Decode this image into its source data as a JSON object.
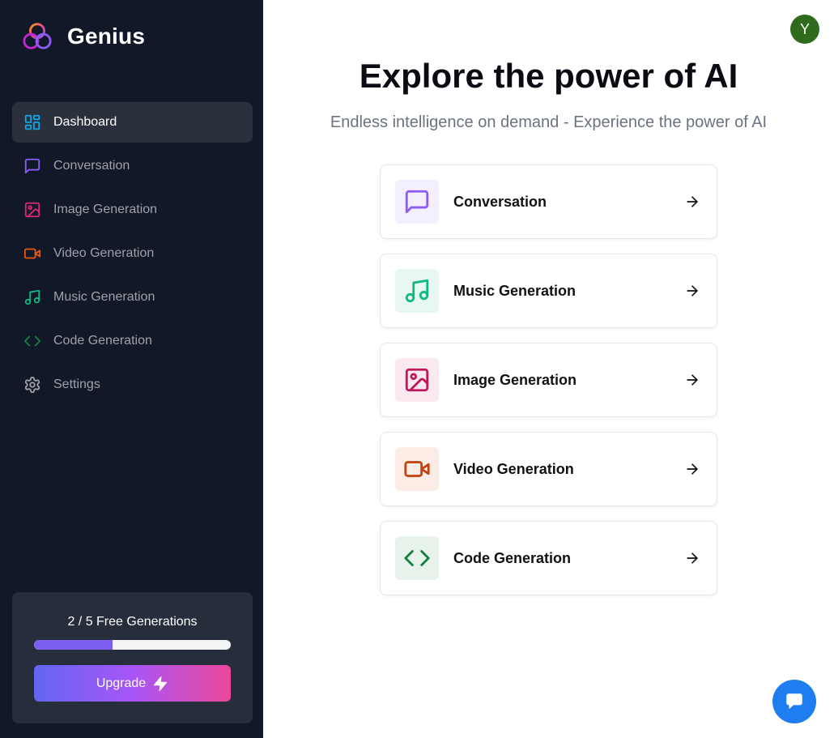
{
  "brand": {
    "name": "Genius"
  },
  "sidebar": {
    "items": [
      {
        "label": "Dashboard",
        "icon": "layout-dashboard-icon",
        "color": "#0ea5e9",
        "active": true
      },
      {
        "label": "Conversation",
        "icon": "message-square-icon",
        "color": "#8b5cf6",
        "active": false
      },
      {
        "label": "Image Generation",
        "icon": "image-icon",
        "color": "#db2777",
        "active": false
      },
      {
        "label": "Video Generation",
        "icon": "video-icon",
        "color": "#ea580c",
        "active": false
      },
      {
        "label": "Music Generation",
        "icon": "music-icon",
        "color": "#10b981",
        "active": false
      },
      {
        "label": "Code Generation",
        "icon": "code-icon",
        "color": "#15803d",
        "active": false
      },
      {
        "label": "Settings",
        "icon": "settings-icon",
        "color": "#a1a1aa",
        "active": false
      }
    ]
  },
  "usage": {
    "text": "2 / 5 Free Generations",
    "used": 2,
    "limit": 5,
    "upgrade_label": "Upgrade"
  },
  "header": {
    "avatar_initial": "Y",
    "avatar_color": "#2f6b1c"
  },
  "main": {
    "title": "Explore the power of AI",
    "subtitle": "Endless intelligence on demand - Experience the power of AI",
    "tools": [
      {
        "label": "Conversation",
        "icon": "message-square-icon",
        "color": "#8b5cf6",
        "bg": "#f3effe"
      },
      {
        "label": "Music Generation",
        "icon": "music-icon",
        "color": "#10b981",
        "bg": "#e8f8f1"
      },
      {
        "label": "Image Generation",
        "icon": "image-icon",
        "color": "#be185d",
        "bg": "#fbe9f0"
      },
      {
        "label": "Video Generation",
        "icon": "video-icon",
        "color": "#c2410c",
        "bg": "#fbede6"
      },
      {
        "label": "Code Generation",
        "icon": "code-icon",
        "color": "#15803d",
        "bg": "#e7f3ea"
      }
    ]
  },
  "chat_widget": {
    "icon": "chat-bubble-icon",
    "color": "#1e7ef0"
  }
}
